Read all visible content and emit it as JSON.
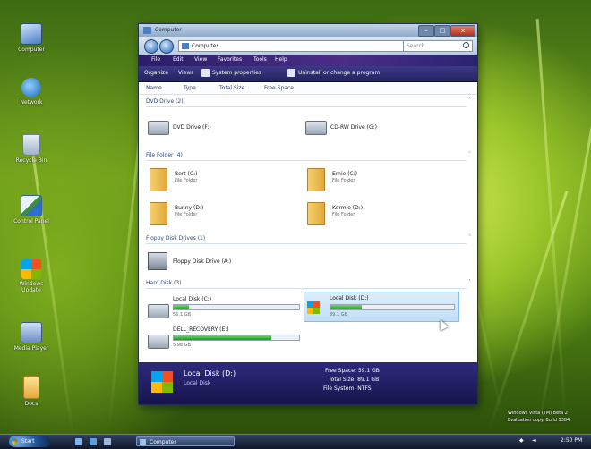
{
  "desktop": {
    "icons": [
      {
        "label": "Computer",
        "icon": "computer-icon"
      },
      {
        "label": "Network",
        "icon": "network-icon"
      },
      {
        "label": "Recycle Bin",
        "icon": "recycle-bin-icon"
      },
      {
        "label": "Control Panel",
        "icon": "control-panel-icon"
      },
      {
        "label": "Windows Update",
        "icon": "windows-icon"
      },
      {
        "label": "Media Player",
        "icon": "media-icon"
      },
      {
        "label": "Docs",
        "icon": "folder-icon"
      }
    ],
    "watermark_line1": "Windows Vista (TM) Beta 2",
    "watermark_line2": "Evaluation copy. Build 5384"
  },
  "window": {
    "title": "Computer",
    "address": "Computer",
    "search_placeholder": "Search",
    "min_label": "–",
    "max_label": "□",
    "close_label": "x",
    "menu": [
      "File",
      "Edit",
      "View",
      "Favorites",
      "Tools",
      "Help"
    ],
    "toolbar": [
      "Organize",
      "Views",
      "System properties",
      "Uninstall or change a program"
    ],
    "columns": [
      "Name",
      "Type",
      "Total Size",
      "Free Space"
    ],
    "groups": {
      "dvd": {
        "header": "DVD Drive (2)",
        "items": [
          {
            "name": "DVD Drive (F:)"
          },
          {
            "name": "CD-RW Drive (G:)"
          }
        ]
      },
      "folders": {
        "header": "File Folder (4)",
        "items": [
          {
            "name": "Bert (C:)",
            "sub": "File Folder"
          },
          {
            "name": "Ernie (C:)",
            "sub": "File Folder"
          },
          {
            "name": "Bunny (D:)",
            "sub": "File Folder"
          },
          {
            "name": "Kermie (D:)",
            "sub": "File Folder"
          }
        ]
      },
      "floppy": {
        "header": "Floppy Disk Drives (1)",
        "items": [
          {
            "name": "Floppy Disk Drive (A:)"
          }
        ]
      },
      "hard": {
        "header": "Hard Disk (3)",
        "items": [
          {
            "name": "Local Disk (C:)",
            "sub": "56.1 GB",
            "fill": 0.12
          },
          {
            "name": "Local Disk (D:)",
            "sub": "89.1 GB",
            "fill": 0.25
          },
          {
            "name": "DELL_RECOVERY (E:)",
            "sub": "5.98 GB",
            "fill": 0.78
          }
        ]
      }
    },
    "details": {
      "name": "Local Disk (D:)",
      "type": "Local Disk",
      "free_label": "Free Space: 59.1 GB",
      "total_label": "Total Size: 89.1 GB",
      "fs_label": "File System: NTFS"
    }
  },
  "taskbar": {
    "start_label": "Start",
    "task_label": "Computer",
    "clock": "2:50 PM"
  },
  "colors": {
    "accent": "#2d2a7e",
    "progress": "#1f9a1f"
  }
}
